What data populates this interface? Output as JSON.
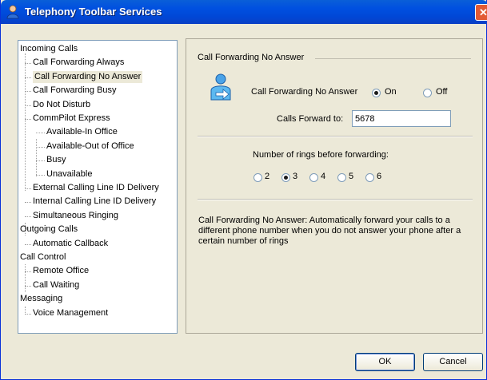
{
  "window": {
    "title": "Telephony Toolbar Services",
    "close_glyph": "✕"
  },
  "tree": {
    "items": [
      {
        "label": "Incoming Calls",
        "level": 0
      },
      {
        "label": "Call Forwarding Always",
        "level": 1
      },
      {
        "label": "Call Forwarding No Answer",
        "level": 1,
        "selected": true
      },
      {
        "label": "Call Forwarding Busy",
        "level": 1
      },
      {
        "label": "Do Not Disturb",
        "level": 1
      },
      {
        "label": "CommPilot Express",
        "level": 1
      },
      {
        "label": "Available-In Office",
        "level": 2
      },
      {
        "label": "Available-Out of Office",
        "level": 2
      },
      {
        "label": "Busy",
        "level": 2
      },
      {
        "label": "Unavailable",
        "level": 2
      },
      {
        "label": "External Calling Line ID Delivery",
        "level": 1
      },
      {
        "label": "Internal Calling Line ID Delivery",
        "level": 1
      },
      {
        "label": "Simultaneous Ringing",
        "level": 1
      },
      {
        "label": "Outgoing Calls",
        "level": 0
      },
      {
        "label": "Automatic Callback",
        "level": 1
      },
      {
        "label": "Call Control",
        "level": 0
      },
      {
        "label": "Remote Office",
        "level": 1
      },
      {
        "label": "Call Waiting",
        "level": 1
      },
      {
        "label": "Messaging",
        "level": 0
      },
      {
        "label": "Voice Management",
        "level": 1
      }
    ]
  },
  "panel": {
    "group_title": "Call Forwarding No Answer",
    "setting_label": "Call Forwarding No Answer",
    "on_label": "On",
    "off_label": "Off",
    "on_selected": true,
    "forward_label": "Calls Forward to:",
    "forward_value": "5678",
    "rings_label": "Number of rings before forwarding:",
    "rings_options": [
      "2",
      "3",
      "4",
      "5",
      "6"
    ],
    "rings_selected": "3",
    "description": "Call Forwarding No Answer: Automatically forward your calls to a different phone number when you do not answer your phone after a certain number of rings"
  },
  "buttons": {
    "ok": "OK",
    "cancel": "Cancel"
  }
}
